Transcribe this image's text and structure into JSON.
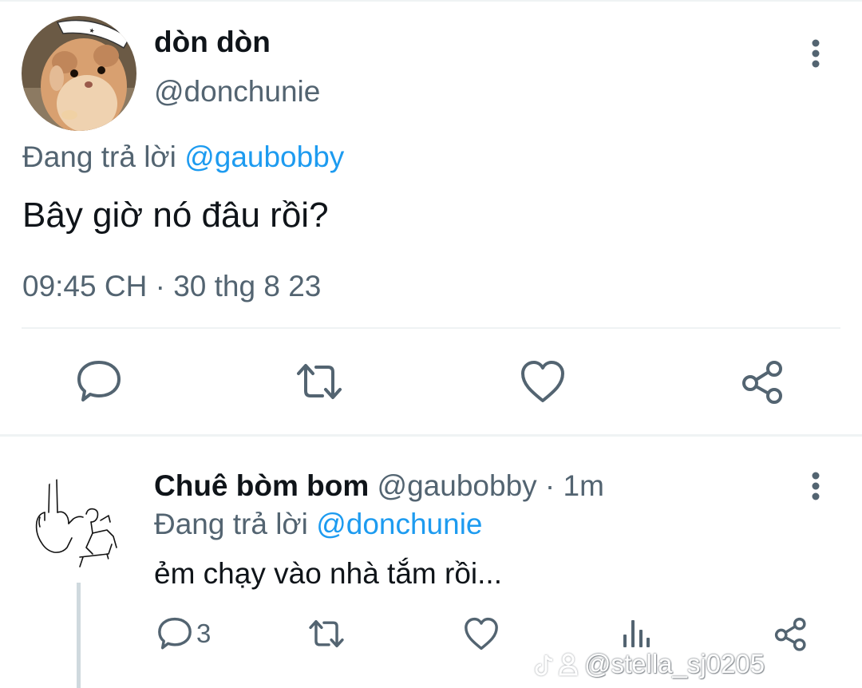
{
  "main_tweet": {
    "display_name": "dòn dòn",
    "handle": "@donchunie",
    "replying_label": "Đang trả lời",
    "replying_to": "@gaubobby",
    "text": "Bây giờ nó đâu rồi?",
    "timestamp": "09:45 CH · 30 thg 8 23",
    "actions": [
      "reply-icon",
      "retweet-icon",
      "like-icon",
      "share-icon"
    ]
  },
  "reply_tweet": {
    "display_name": "Chuê bòm bom",
    "handle": "@gaubobby",
    "time_ago": " · 1m",
    "replying_label": "Đang trả lời",
    "replying_to": "@donchunie",
    "text": "ẻm chạy vào nhà tắm rồi...",
    "reply_count": "3",
    "actions": [
      "reply-icon",
      "retweet-icon",
      "like-icon",
      "views-icon",
      "share-icon"
    ]
  },
  "watermark": {
    "text": "@stella_sj0205",
    "icons": [
      "tiktok-logo-icon",
      "user-icon"
    ]
  },
  "colors": {
    "text_primary": "#0f1419",
    "text_secondary": "#536471",
    "link": "#1d9bf0",
    "divider": "#eff3f4"
  }
}
